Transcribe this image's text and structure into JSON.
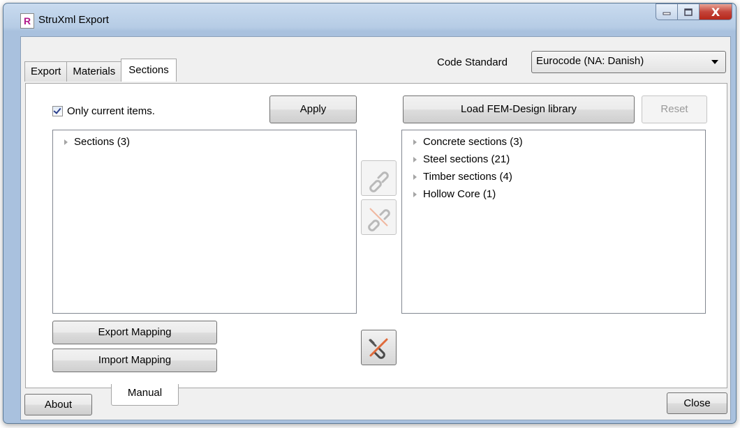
{
  "window": {
    "title": "StruXml Export",
    "icon_letter": "R",
    "controls": {
      "minimize": "—",
      "maximize": "▢",
      "close": "X"
    }
  },
  "tabs": [
    {
      "label": "Export",
      "active": false
    },
    {
      "label": "Materials",
      "active": false
    },
    {
      "label": "Sections",
      "active": true
    }
  ],
  "code_standard": {
    "label": "Code Standard",
    "value": "Eurocode (NA: Danish)"
  },
  "sections_panel": {
    "only_current": {
      "label": "Only current items.",
      "checked": true
    },
    "apply_label": "Apply",
    "load_library_label": "Load FEM-Design library",
    "reset_label": "Reset",
    "left_tree": [
      {
        "label": "Sections  (3)"
      }
    ],
    "right_tree": [
      {
        "label": "Concrete sections  (3)"
      },
      {
        "label": "Steel sections  (21)"
      },
      {
        "label": "Timber sections  (4)"
      },
      {
        "label": "Hollow Core  (1)"
      }
    ],
    "export_mapping_label": "Export Mapping",
    "import_mapping_label": "Import Mapping",
    "link_icon": "link-icon",
    "unlink_icon": "unlink-icon",
    "unlink_all_icon": "unlink-all-icon"
  },
  "footer": {
    "manual_label": "Manual",
    "about_label": "About",
    "close_label": "Close"
  },
  "colors": {
    "frame": "#b6cce5",
    "client_bg": "#f0f0f0",
    "close_button": "#c4443a",
    "unlink_cross": "#e06a3a"
  }
}
